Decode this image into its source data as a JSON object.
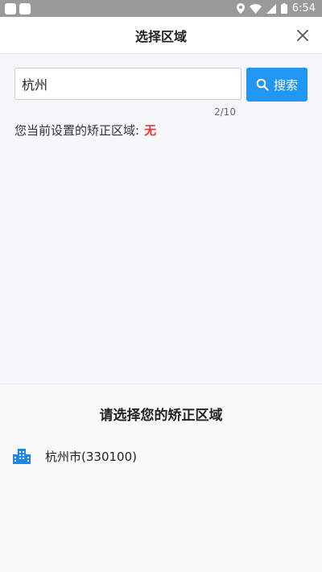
{
  "status_bar": {
    "time": "6:54",
    "icons": [
      "location-icon",
      "wifi-icon",
      "signal-icon",
      "battery-icon"
    ]
  },
  "header": {
    "title": "选择区域",
    "close_icon": "close-icon"
  },
  "search": {
    "value": "杭州",
    "button_label": "搜索",
    "counter": "2/10"
  },
  "current": {
    "label": "您当前设置的矫正区域:",
    "value": "无"
  },
  "panel": {
    "title": "请选择您的矫正区域",
    "items": [
      {
        "label": "杭州市(330100)",
        "icon": "building-icon"
      }
    ]
  },
  "colors": {
    "accent": "#2196f3",
    "highlight": "#e53935",
    "status_bar": "#9a9a9a"
  }
}
